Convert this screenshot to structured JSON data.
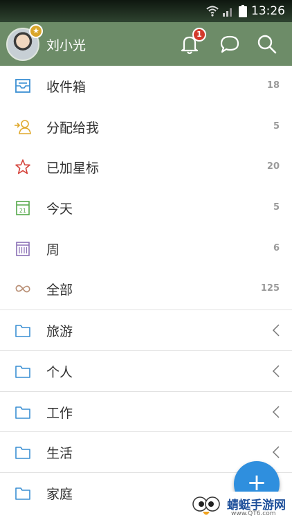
{
  "status_bar": {
    "time": "13:26"
  },
  "header": {
    "username": "刘小光",
    "notification_count": "1"
  },
  "menu": [
    {
      "label": "收件箱",
      "count": "18",
      "icon": "inbox-icon"
    },
    {
      "label": "分配给我",
      "count": "5",
      "icon": "assign-icon"
    },
    {
      "label": "已加星标",
      "count": "20",
      "icon": "star-icon"
    },
    {
      "label": "今天",
      "count": "5",
      "icon": "calendar-icon"
    },
    {
      "label": "周",
      "count": "6",
      "icon": "week-icon"
    },
    {
      "label": "全部",
      "count": "125",
      "icon": "infinity-icon"
    }
  ],
  "folders": [
    {
      "label": "旅游"
    },
    {
      "label": "个人"
    },
    {
      "label": "工作"
    },
    {
      "label": "生活"
    },
    {
      "label": "家庭"
    }
  ],
  "calendar_icon_day": "21",
  "fab": {
    "label": "+"
  },
  "watermark": {
    "text": "蜻蜓手游网",
    "url": "www.QT6.com"
  },
  "colors": {
    "header": "#6d8c68",
    "accent": "#2f8fde",
    "badge": "#d33a2c"
  }
}
